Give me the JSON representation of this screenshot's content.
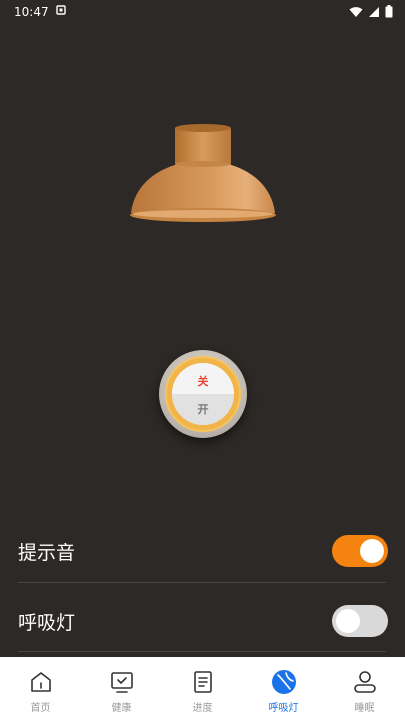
{
  "status_bar": {
    "time": "10:47"
  },
  "knob": {
    "off_label": "关",
    "on_label": "开"
  },
  "settings": [
    {
      "label": "提示音",
      "enabled": true
    },
    {
      "label": "呼吸灯",
      "enabled": false
    }
  ],
  "tabbar": {
    "items": [
      {
        "label": "首页",
        "icon": "home-icon",
        "active": false
      },
      {
        "label": "健康",
        "icon": "monitor-check-icon",
        "active": false
      },
      {
        "label": "进度",
        "icon": "document-icon",
        "active": false
      },
      {
        "label": "呼吸灯",
        "icon": "ball-icon",
        "active": true
      },
      {
        "label": "睡眠",
        "icon": "user-icon",
        "active": false
      }
    ]
  },
  "colors": {
    "background": "#2d2926",
    "toggle_on": "#f5830f",
    "toggle_off": "#d9d9d9",
    "tab_active": "#1a73e8",
    "knob_ring": "#f0b448"
  }
}
